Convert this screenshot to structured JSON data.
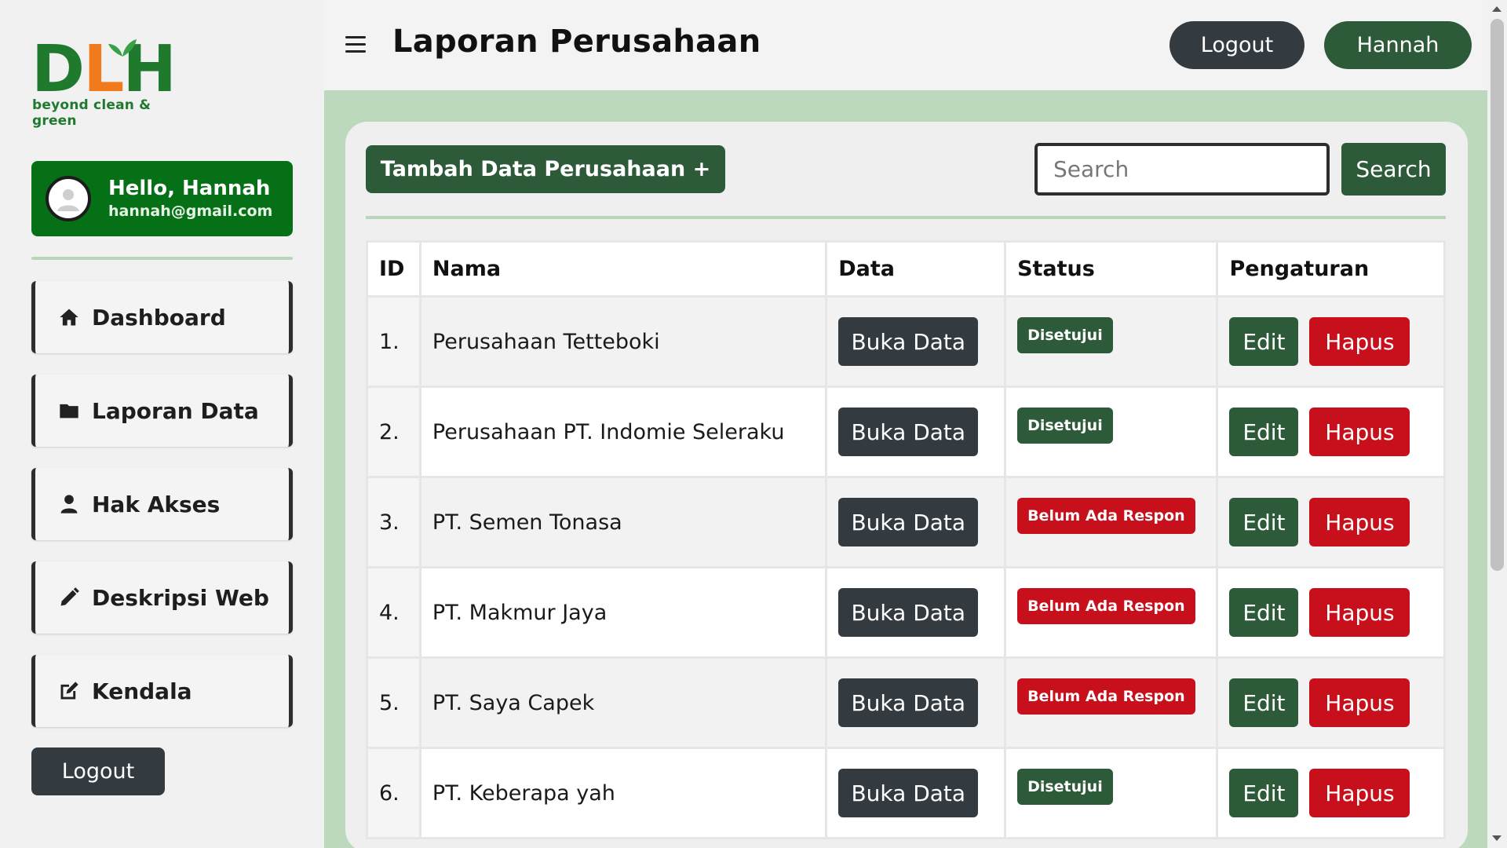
{
  "brand": {
    "logo_d": "D",
    "logo_l": "L",
    "logo_h": "H",
    "tagline": "beyond clean & green",
    "primary_color": "#2d5a38",
    "accent_color": "#f07a1c"
  },
  "user": {
    "greeting": "Hello, Hannah",
    "email": "hannah@gmail.com"
  },
  "sidebar": {
    "items": [
      {
        "label": "Dashboard",
        "icon": "home-icon"
      },
      {
        "label": "Laporan Data",
        "icon": "folder-icon"
      },
      {
        "label": "Hak Akses",
        "icon": "user-icon"
      },
      {
        "label": "Deskripsi Web",
        "icon": "pencil-icon"
      },
      {
        "label": "Kendala",
        "icon": "edit-square-icon"
      }
    ],
    "logout_label": "Logout"
  },
  "header": {
    "title": "Laporan Perusahaan",
    "logout_label": "Logout",
    "user_label": "Hannah"
  },
  "toolbar": {
    "add_label": "Tambah Data Perusahaan +",
    "search_placeholder": "Search",
    "search_label": "Search"
  },
  "table": {
    "headers": [
      "ID",
      "Nama",
      "Data",
      "Status",
      "Pengaturan"
    ],
    "rows": [
      {
        "id": "1.",
        "name": "Perusahaan Tetteboki",
        "data_label": "Buka Data",
        "status": "Disetujui",
        "status_type": "ok",
        "edit": "Edit",
        "delete": "Hapus"
      },
      {
        "id": "2.",
        "name": "Perusahaan PT. Indomie Seleraku",
        "data_label": "Buka Data",
        "status": "Disetujui",
        "status_type": "ok",
        "edit": "Edit",
        "delete": "Hapus"
      },
      {
        "id": "3.",
        "name": "PT. Semen Tonasa",
        "data_label": "Buka Data",
        "status": "Belum Ada Respon",
        "status_type": "no",
        "edit": "Edit",
        "delete": "Hapus"
      },
      {
        "id": "4.",
        "name": "PT. Makmur Jaya",
        "data_label": "Buka Data",
        "status": "Belum Ada Respon",
        "status_type": "no",
        "edit": "Edit",
        "delete": "Hapus"
      },
      {
        "id": "5.",
        "name": "PT. Saya Capek",
        "data_label": "Buka Data",
        "status": "Belum Ada Respon",
        "status_type": "no",
        "edit": "Edit",
        "delete": "Hapus"
      },
      {
        "id": "6.",
        "name": "PT. Keberapa yah",
        "data_label": "Buka Data",
        "status": "Disetujui",
        "status_type": "ok",
        "edit": "Edit",
        "delete": "Hapus"
      }
    ]
  }
}
